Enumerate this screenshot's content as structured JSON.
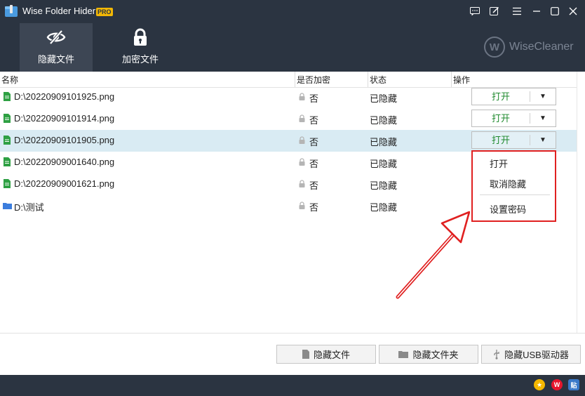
{
  "app": {
    "title": "Wise Folder Hider",
    "badge": "PRO"
  },
  "nav": [
    {
      "label": "隐藏文件",
      "icon": "eye-slash-icon",
      "active": true
    },
    {
      "label": "加密文件",
      "icon": "lock-icon",
      "active": false
    }
  ],
  "brand": {
    "logo_letter": "W",
    "text": "WiseCleaner"
  },
  "columns": {
    "name": "名称",
    "encrypted": "是否加密",
    "status": "状态",
    "action": "操作"
  },
  "rows": [
    {
      "name": "D:\\20220909101925.png",
      "type": "file",
      "encrypted": "否",
      "status": "已隐藏",
      "open": "打开"
    },
    {
      "name": "D:\\20220909101914.png",
      "type": "file",
      "encrypted": "否",
      "status": "已隐藏",
      "open": "打开"
    },
    {
      "name": "D:\\20220909101905.png",
      "type": "file",
      "encrypted": "否",
      "status": "已隐藏",
      "open": "打开",
      "selected": true
    },
    {
      "name": "D:\\20220909001640.png",
      "type": "file",
      "encrypted": "否",
      "status": "已隐藏"
    },
    {
      "name": "D:\\20220909001621.png",
      "type": "file",
      "encrypted": "否",
      "status": "已隐藏"
    },
    {
      "name": "D:\\测试",
      "type": "folder",
      "encrypted": "否",
      "status": "已隐藏"
    }
  ],
  "dropdown_menu": {
    "items": [
      "打开",
      "取消隐藏",
      "设置密码"
    ]
  },
  "bottom_buttons": {
    "hide_file": "隐藏文件",
    "hide_folder": "隐藏文件夹",
    "hide_usb": "隐藏USB驱动器"
  },
  "colors": {
    "titlebar": "#2b3441",
    "accent_green": "#1f8a2e",
    "highlight_red": "#e02020",
    "selected_row": "#d9ebf3"
  }
}
